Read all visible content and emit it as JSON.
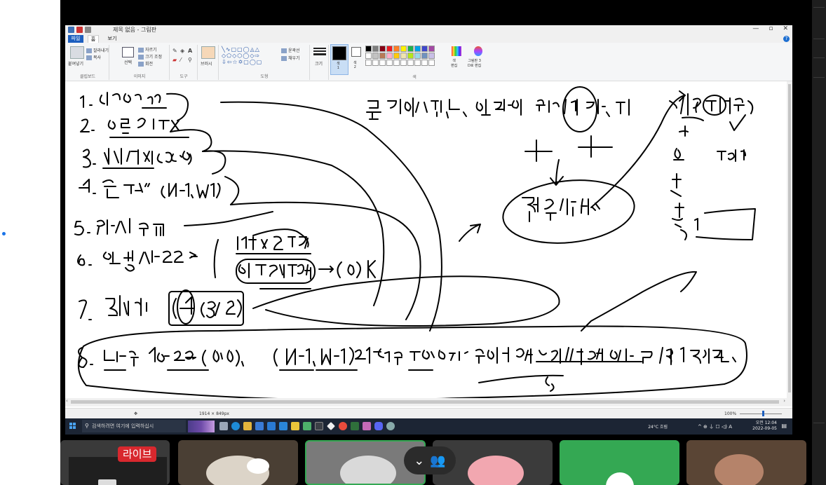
{
  "window": {
    "title": "제목 없음 - 그림판",
    "controls": [
      "—",
      "▫",
      "✕"
    ]
  },
  "ribbon": {
    "tabs": [
      "파일",
      "홈",
      "보기"
    ],
    "clipboard": {
      "paste": "붙여넣기",
      "cut": "잘라내기",
      "copy": "복사",
      "group": "클립보드"
    },
    "image": {
      "select": "선택",
      "crop": "자르기",
      "resize": "크기 조정",
      "rotate": "회전",
      "group": "이미지"
    },
    "tools": {
      "group": "도구",
      "text": "A"
    },
    "brushes": {
      "label": "브러시"
    },
    "shapes": {
      "outline": "윤곽선",
      "fill": "채우기",
      "group": "도형"
    },
    "size": {
      "label": "크기"
    },
    "color1": {
      "label": "색\n1"
    },
    "color2": {
      "label": "색\n2"
    },
    "edit_colors": {
      "label": "색\n편집"
    },
    "paint3d": {
      "label": "그림판 3\nD로 편집"
    },
    "colors_group": "색",
    "palette": [
      "#000000",
      "#7f7f7f",
      "#880015",
      "#ed1c24",
      "#ff7f27",
      "#fff200",
      "#22b14c",
      "#00a2e8",
      "#3f48cc",
      "#a349a4",
      "#ffffff",
      "#c3c3c3",
      "#b97a57",
      "#ffaec9",
      "#ffc90e",
      "#efe4b0",
      "#b5e61d",
      "#99d9ea",
      "#7092be",
      "#c8bfe7",
      "#ffffff",
      "#ffffff",
      "#ffffff",
      "#ffffff",
      "#ffffff",
      "#ffffff",
      "#ffffff",
      "#ffffff",
      "#ffffff",
      "#ffffff"
    ]
  },
  "status": {
    "dimensions": "1914 × 849px",
    "zoom": "100%"
  },
  "taskbar": {
    "search_placeholder": "검색하려면 여기에 입력하십시",
    "weather": "24°C 흐림",
    "sys_icons": "^ ⊕ ⏚ ☐ ◁) A",
    "time": "오전 12:04",
    "date": "2022-09-05"
  },
  "meeting": {
    "live_label": "라이브"
  },
  "accent": "#1d5fbf"
}
